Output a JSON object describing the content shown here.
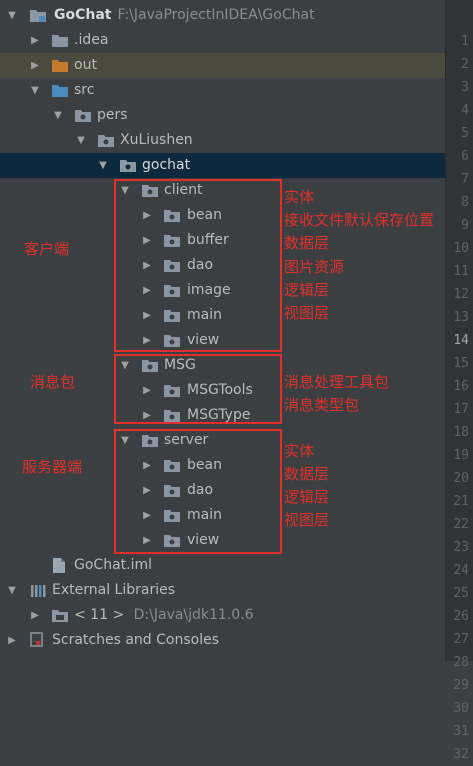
{
  "project_tree": {
    "root": {
      "name": "GoChat",
      "path": "F:\\JavaProjectInIDEA\\GoChat"
    },
    "idea": ".idea",
    "out": "out",
    "src": "src",
    "pers": "pers",
    "xuliushen": "XuLiushen",
    "gochat": "gochat",
    "client": {
      "label": "client",
      "children": [
        "bean",
        "buffer",
        "dao",
        "image",
        "main",
        "view"
      ]
    },
    "msg": {
      "label": "MSG",
      "children": [
        "MSGTools",
        "MSGType"
      ]
    },
    "server": {
      "label": "server",
      "children": [
        "bean",
        "dao",
        "main",
        "view"
      ]
    },
    "iml": "GoChat.iml",
    "external_libraries": "External Libraries",
    "jdk": {
      "version": "< 11 >",
      "path": "D:\\Java\\jdk11.0.6"
    },
    "scratches": "Scratches and Consoles"
  },
  "line_numbers": [
    "1",
    "2",
    "3",
    "4",
    "5",
    "6",
    "7",
    "8",
    "9",
    "10",
    "11",
    "12",
    "13",
    "14",
    "15",
    "16",
    "17",
    "18",
    "19",
    "20",
    "21",
    "22",
    "23",
    "24",
    "25",
    "26",
    "27",
    "28",
    "29",
    "30",
    "31",
    "32"
  ],
  "current_line": "14",
  "annotations": {
    "client_title": "客户端",
    "client_notes": [
      "实体",
      "接收文件默认保存位置",
      "数据层",
      "图片资源",
      "逻辑层",
      "视图层"
    ],
    "msg_title": "消息包",
    "msg_notes": [
      "消息处理工具包",
      "消息类型包"
    ],
    "server_title": "服务器端",
    "server_notes": [
      "实体",
      "数据层",
      "逻辑层",
      "视图层"
    ]
  },
  "colors": {
    "background": "#3c3f41",
    "selection": "#0d293e",
    "excluded_row": "#4b4a3e",
    "folder": "#8a97a3",
    "source_folder": "#4a8cbf",
    "excluded_folder": "#c57a2b",
    "annotation": "#e0302a"
  }
}
